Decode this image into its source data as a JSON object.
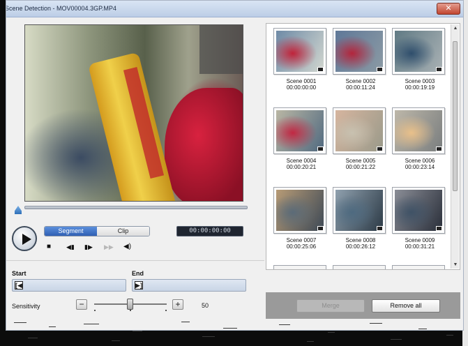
{
  "window": {
    "title": "Scene Detection - MOV00004.3GP.MP4",
    "close_glyph": "✕"
  },
  "player": {
    "mode_tabs": [
      {
        "label": "Segment",
        "active": true
      },
      {
        "label": "Clip",
        "active": false
      }
    ],
    "timecode": "00:00:00:00",
    "controls": {
      "stop": "■",
      "prev_frame": "◀▮",
      "next_frame": "▮▶",
      "fast_forward": "▶▶",
      "volume": "◀)"
    }
  },
  "trim": {
    "start_label": "Start",
    "end_label": "End",
    "start_icon": "[◀",
    "end_icon": "▶]"
  },
  "sensitivity": {
    "label": "Sensitivity",
    "minus": "−",
    "plus": "+",
    "value": "50",
    "level": 0.5
  },
  "scenes": [
    {
      "name": "Scene 0001",
      "time": "00:00:00:00",
      "colors": [
        "#c0233a",
        "#6e8aa6",
        "#d1d6cf"
      ]
    },
    {
      "name": "Scene 0002",
      "time": "00:00:11:24",
      "colors": [
        "#b3253c",
        "#5f7898",
        "#8b9aa4"
      ]
    },
    {
      "name": "Scene 0003",
      "time": "00:00:19:19",
      "colors": [
        "#2f4e6c",
        "#607a84",
        "#a9b1b4"
      ]
    },
    {
      "name": "Scene 0004",
      "time": "00:00:20:21",
      "colors": [
        "#c22843",
        "#b9b6a4",
        "#516a80"
      ]
    },
    {
      "name": "Scene 0005",
      "time": "00:00:21:22",
      "colors": [
        "#c8c1b0",
        "#d6b59f",
        "#9a9a8a"
      ]
    },
    {
      "name": "Scene 0006",
      "time": "00:00:23:14",
      "colors": [
        "#e9c08a",
        "#bdb7a9",
        "#7a7e7f"
      ]
    },
    {
      "name": "Scene 0007",
      "time": "00:00:25:06",
      "colors": [
        "#5b6b78",
        "#b79b76",
        "#3d4956"
      ]
    },
    {
      "name": "Scene 0008",
      "time": "00:00:26:12",
      "colors": [
        "#4e6a80",
        "#8fa0ae",
        "#2c3a46"
      ]
    },
    {
      "name": "Scene 0009",
      "time": "00:00:31:21",
      "colors": [
        "#3f5266",
        "#8a8d96",
        "#2a2f3a"
      ]
    }
  ],
  "actions": {
    "merge_label": "Merge",
    "remove_all_label": "Remove all"
  }
}
